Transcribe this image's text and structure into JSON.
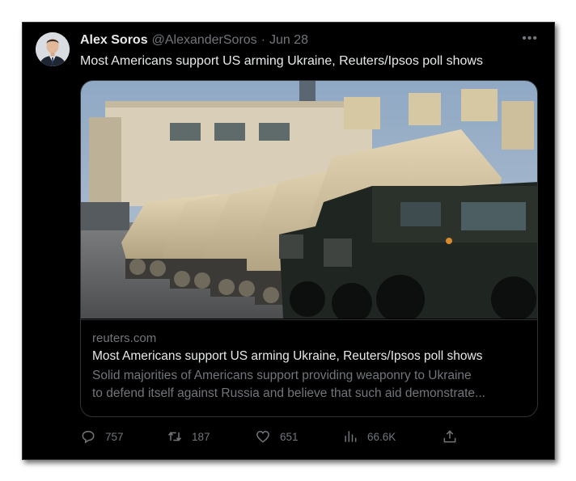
{
  "tweet": {
    "author_name": "Alex Soros",
    "author_handle": "@AlexanderSoros",
    "separator": "·",
    "date": "Jun 28",
    "more_label": "•••",
    "text": "Most Americans support US arming Ukraine, Reuters/Ipsos poll shows"
  },
  "card": {
    "domain": "reuters.com",
    "title": "Most Americans support US arming Ukraine, Reuters/Ipsos poll shows",
    "description_line1": "Solid majorities of Americans support providing weaponry to Ukraine",
    "description_line2": "to defend itself against Russia and believe that such aid demonstrate...",
    "image_icon": "military-vehicles-photo"
  },
  "actions": {
    "replies": "757",
    "retweets": "187",
    "likes": "651",
    "views": "66.6K"
  },
  "icons": {
    "reply": "reply-icon",
    "retweet": "retweet-icon",
    "like": "heart-icon",
    "views": "views-icon",
    "share": "share-icon"
  },
  "colors": {
    "background": "#000000",
    "primary_text": "#e7e9ea",
    "secondary_text": "#71767b",
    "border": "#2f3336"
  }
}
